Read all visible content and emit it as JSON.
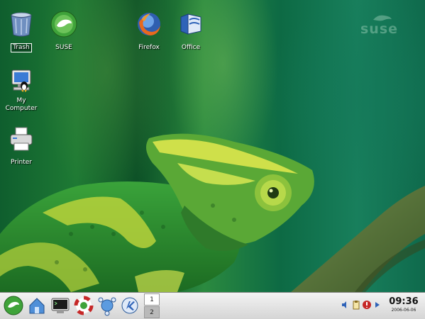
{
  "desktop": {
    "watermark": "suse",
    "icons": [
      {
        "label": "Trash",
        "selected": true,
        "icon": "trash-icon"
      },
      {
        "label": "SUSE",
        "icon": "suse-gecko-icon"
      },
      {
        "label": "Firefox",
        "icon": "firefox-icon"
      },
      {
        "label": "Office",
        "icon": "office-icon"
      },
      {
        "label": "My Computer",
        "icon": "my-computer-icon"
      },
      {
        "label": "Printer",
        "icon": "printer-icon"
      }
    ]
  },
  "panel": {
    "launchers": [
      {
        "name": "suse-menu-button",
        "icon": "suse-gecko-icon"
      },
      {
        "name": "home-launcher",
        "icon": "home-icon"
      },
      {
        "name": "terminal-launcher",
        "icon": "terminal-icon"
      },
      {
        "name": "help-launcher",
        "icon": "lifebuoy-icon"
      },
      {
        "name": "network-launcher",
        "icon": "network-icon"
      },
      {
        "name": "browser-launcher",
        "icon": "konqueror-icon"
      }
    ],
    "pager": [
      "1",
      "2"
    ],
    "tray": [
      "volume-icon",
      "clipboard-icon",
      "update-icon",
      "arrow-icon"
    ],
    "clock": {
      "time": "09:36",
      "date": "2006-06-06"
    }
  },
  "colors": {
    "panel_bg": "#dcdcdc",
    "wallpaper_green": "#1e7a34"
  }
}
